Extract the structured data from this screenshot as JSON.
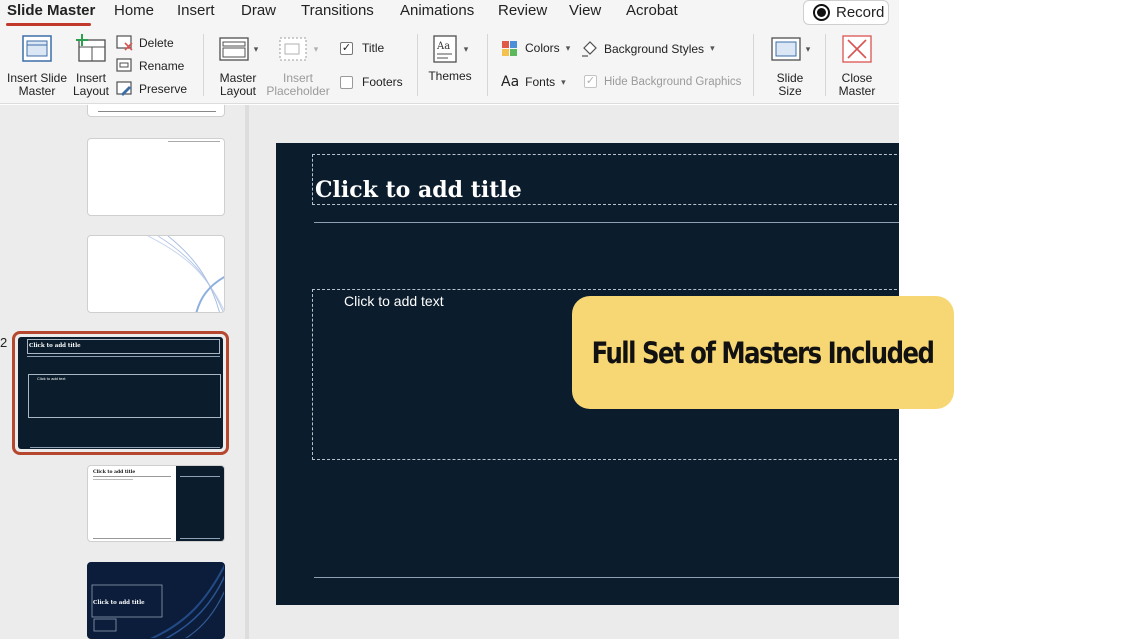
{
  "tabs": [
    {
      "label": "Slide Master",
      "active": true
    },
    {
      "label": "Home"
    },
    {
      "label": "Insert"
    },
    {
      "label": "Draw"
    },
    {
      "label": "Transitions"
    },
    {
      "label": "Animations"
    },
    {
      "label": "Review"
    },
    {
      "label": "View"
    },
    {
      "label": "Acrobat"
    }
  ],
  "record_label": "Record",
  "ribbon": {
    "insert_slide_master": "Insert Slide Master",
    "insert_slide_master_l1": "Insert Slide",
    "insert_slide_master_l2": "Master",
    "insert_layout_l1": "Insert",
    "insert_layout_l2": "Layout",
    "delete": "Delete",
    "rename": "Rename",
    "preserve": "Preserve",
    "master_layout_l1": "Master",
    "master_layout_l2": "Layout",
    "insert_placeholder_l1": "Insert",
    "insert_placeholder_l2": "Placeholder",
    "title_checkbox": "Title",
    "footers_checkbox": "Footers",
    "themes": "Themes",
    "colors": "Colors",
    "fonts": "Fonts",
    "background_styles": "Background Styles",
    "hide_background_graphics": "Hide Background Graphics",
    "slide_size_l1": "Slide",
    "slide_size_l2": "Size",
    "close_master_l1": "Close",
    "close_master_l2": "Master"
  },
  "checkbox_state": {
    "title": true,
    "footers": false,
    "hide_background_graphics": true
  },
  "thumbnails": {
    "selected_number": "2",
    "selected_title": "Click to add title",
    "selected_body": "Click to add text",
    "thumb5_title": "Click to add title",
    "thumb6_title": "Click to add title"
  },
  "slide": {
    "title_placeholder": "Click to add title",
    "body_placeholder": "Click to add text"
  },
  "callout": "Full Set of Masters Included",
  "colors": {
    "accent_tab": "#c0392b",
    "slide_bg": "#0b1d2c",
    "selection_frame": "#b5472f",
    "callout_bg": "#f7d774",
    "close_icon": "#d9534f"
  }
}
